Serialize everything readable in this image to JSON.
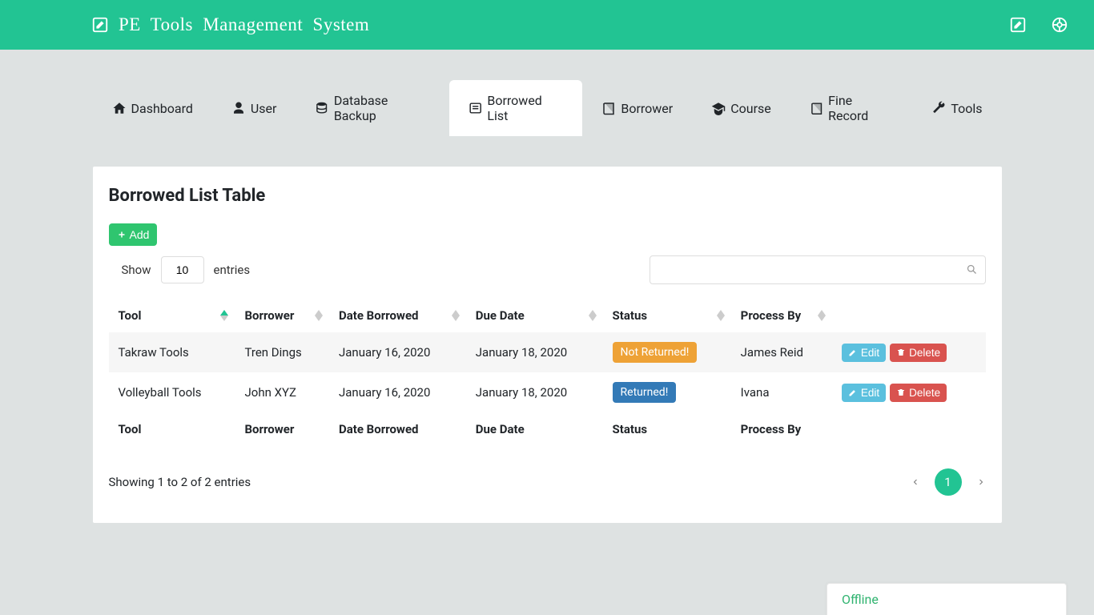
{
  "brand": {
    "title": "PE Tools Management System"
  },
  "nav": [
    {
      "label": "Dashboard",
      "icon": "home-icon",
      "active": false
    },
    {
      "label": "User",
      "icon": "user-icon",
      "active": false
    },
    {
      "label": "Database Backup",
      "icon": "database-icon",
      "active": false
    },
    {
      "label": "Borrowed List",
      "icon": "list-icon",
      "active": true
    },
    {
      "label": "Borrower",
      "icon": "book-icon",
      "active": false
    },
    {
      "label": "Course",
      "icon": "gradcap-icon",
      "active": false
    },
    {
      "label": "Fine Record",
      "icon": "book-icon",
      "active": false
    },
    {
      "label": "Tools",
      "icon": "wrench-icon",
      "active": false
    }
  ],
  "page": {
    "title": "Borrowed List Table",
    "add_label": "Add",
    "show_label": "Show",
    "entries_label": "entries",
    "show_value": "10",
    "search_value": "",
    "info": "Showing 1 to 2 of 2 entries",
    "page_number": "1",
    "edit_label": "Edit",
    "delete_label": "Delete"
  },
  "columns": [
    "Tool",
    "Borrower",
    "Date Borrowed",
    "Due Date",
    "Status",
    "Process By",
    ""
  ],
  "rows": [
    {
      "tool": "Takraw Tools",
      "borrower": "Tren Dings",
      "date_borrowed": "January 16, 2020",
      "due_date": "January 18, 2020",
      "status_label": "Not Returned!",
      "status_kind": "warn",
      "process_by": "James Reid"
    },
    {
      "tool": "Volleyball Tools",
      "borrower": "John XYZ",
      "date_borrowed": "January 16, 2020",
      "due_date": "January 18, 2020",
      "status_label": "Returned!",
      "status_kind": "ok",
      "process_by": "Ivana"
    }
  ],
  "offline_label": "Offline"
}
